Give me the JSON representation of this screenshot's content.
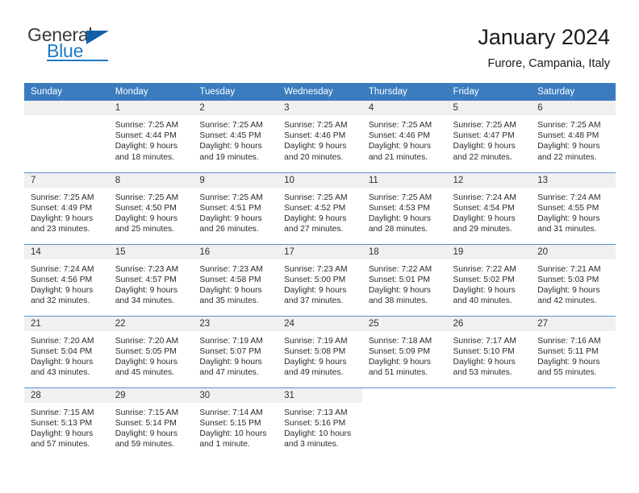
{
  "brand": {
    "name_part1": "General",
    "name_part2": "Blue",
    "accent_color": "#1f7ac4",
    "triangle_color": "#1360a8"
  },
  "header": {
    "title": "January 2024",
    "subtitle": "Furore, Campania, Italy"
  },
  "calendar": {
    "header_bg": "#3a7cbe",
    "daynum_bg": "#f0f0f0",
    "weekday_headers": [
      "Sunday",
      "Monday",
      "Tuesday",
      "Wednesday",
      "Thursday",
      "Friday",
      "Saturday"
    ],
    "weeks": [
      [
        {
          "day": "",
          "sunrise": "",
          "sunset": "",
          "daylight_line1": "",
          "daylight_line2": "",
          "blank": true
        },
        {
          "day": "1",
          "sunrise": "Sunrise: 7:25 AM",
          "sunset": "Sunset: 4:44 PM",
          "daylight_line1": "Daylight: 9 hours",
          "daylight_line2": "and 18 minutes."
        },
        {
          "day": "2",
          "sunrise": "Sunrise: 7:25 AM",
          "sunset": "Sunset: 4:45 PM",
          "daylight_line1": "Daylight: 9 hours",
          "daylight_line2": "and 19 minutes."
        },
        {
          "day": "3",
          "sunrise": "Sunrise: 7:25 AM",
          "sunset": "Sunset: 4:46 PM",
          "daylight_line1": "Daylight: 9 hours",
          "daylight_line2": "and 20 minutes."
        },
        {
          "day": "4",
          "sunrise": "Sunrise: 7:25 AM",
          "sunset": "Sunset: 4:46 PM",
          "daylight_line1": "Daylight: 9 hours",
          "daylight_line2": "and 21 minutes."
        },
        {
          "day": "5",
          "sunrise": "Sunrise: 7:25 AM",
          "sunset": "Sunset: 4:47 PM",
          "daylight_line1": "Daylight: 9 hours",
          "daylight_line2": "and 22 minutes."
        },
        {
          "day": "6",
          "sunrise": "Sunrise: 7:25 AM",
          "sunset": "Sunset: 4:48 PM",
          "daylight_line1": "Daylight: 9 hours",
          "daylight_line2": "and 22 minutes."
        }
      ],
      [
        {
          "day": "7",
          "sunrise": "Sunrise: 7:25 AM",
          "sunset": "Sunset: 4:49 PM",
          "daylight_line1": "Daylight: 9 hours",
          "daylight_line2": "and 23 minutes."
        },
        {
          "day": "8",
          "sunrise": "Sunrise: 7:25 AM",
          "sunset": "Sunset: 4:50 PM",
          "daylight_line1": "Daylight: 9 hours",
          "daylight_line2": "and 25 minutes."
        },
        {
          "day": "9",
          "sunrise": "Sunrise: 7:25 AM",
          "sunset": "Sunset: 4:51 PM",
          "daylight_line1": "Daylight: 9 hours",
          "daylight_line2": "and 26 minutes."
        },
        {
          "day": "10",
          "sunrise": "Sunrise: 7:25 AM",
          "sunset": "Sunset: 4:52 PM",
          "daylight_line1": "Daylight: 9 hours",
          "daylight_line2": "and 27 minutes."
        },
        {
          "day": "11",
          "sunrise": "Sunrise: 7:25 AM",
          "sunset": "Sunset: 4:53 PM",
          "daylight_line1": "Daylight: 9 hours",
          "daylight_line2": "and 28 minutes."
        },
        {
          "day": "12",
          "sunrise": "Sunrise: 7:24 AM",
          "sunset": "Sunset: 4:54 PM",
          "daylight_line1": "Daylight: 9 hours",
          "daylight_line2": "and 29 minutes."
        },
        {
          "day": "13",
          "sunrise": "Sunrise: 7:24 AM",
          "sunset": "Sunset: 4:55 PM",
          "daylight_line1": "Daylight: 9 hours",
          "daylight_line2": "and 31 minutes."
        }
      ],
      [
        {
          "day": "14",
          "sunrise": "Sunrise: 7:24 AM",
          "sunset": "Sunset: 4:56 PM",
          "daylight_line1": "Daylight: 9 hours",
          "daylight_line2": "and 32 minutes."
        },
        {
          "day": "15",
          "sunrise": "Sunrise: 7:23 AM",
          "sunset": "Sunset: 4:57 PM",
          "daylight_line1": "Daylight: 9 hours",
          "daylight_line2": "and 34 minutes."
        },
        {
          "day": "16",
          "sunrise": "Sunrise: 7:23 AM",
          "sunset": "Sunset: 4:58 PM",
          "daylight_line1": "Daylight: 9 hours",
          "daylight_line2": "and 35 minutes."
        },
        {
          "day": "17",
          "sunrise": "Sunrise: 7:23 AM",
          "sunset": "Sunset: 5:00 PM",
          "daylight_line1": "Daylight: 9 hours",
          "daylight_line2": "and 37 minutes."
        },
        {
          "day": "18",
          "sunrise": "Sunrise: 7:22 AM",
          "sunset": "Sunset: 5:01 PM",
          "daylight_line1": "Daylight: 9 hours",
          "daylight_line2": "and 38 minutes."
        },
        {
          "day": "19",
          "sunrise": "Sunrise: 7:22 AM",
          "sunset": "Sunset: 5:02 PM",
          "daylight_line1": "Daylight: 9 hours",
          "daylight_line2": "and 40 minutes."
        },
        {
          "day": "20",
          "sunrise": "Sunrise: 7:21 AM",
          "sunset": "Sunset: 5:03 PM",
          "daylight_line1": "Daylight: 9 hours",
          "daylight_line2": "and 42 minutes."
        }
      ],
      [
        {
          "day": "21",
          "sunrise": "Sunrise: 7:20 AM",
          "sunset": "Sunset: 5:04 PM",
          "daylight_line1": "Daylight: 9 hours",
          "daylight_line2": "and 43 minutes."
        },
        {
          "day": "22",
          "sunrise": "Sunrise: 7:20 AM",
          "sunset": "Sunset: 5:05 PM",
          "daylight_line1": "Daylight: 9 hours",
          "daylight_line2": "and 45 minutes."
        },
        {
          "day": "23",
          "sunrise": "Sunrise: 7:19 AM",
          "sunset": "Sunset: 5:07 PM",
          "daylight_line1": "Daylight: 9 hours",
          "daylight_line2": "and 47 minutes."
        },
        {
          "day": "24",
          "sunrise": "Sunrise: 7:19 AM",
          "sunset": "Sunset: 5:08 PM",
          "daylight_line1": "Daylight: 9 hours",
          "daylight_line2": "and 49 minutes."
        },
        {
          "day": "25",
          "sunrise": "Sunrise: 7:18 AM",
          "sunset": "Sunset: 5:09 PM",
          "daylight_line1": "Daylight: 9 hours",
          "daylight_line2": "and 51 minutes."
        },
        {
          "day": "26",
          "sunrise": "Sunrise: 7:17 AM",
          "sunset": "Sunset: 5:10 PM",
          "daylight_line1": "Daylight: 9 hours",
          "daylight_line2": "and 53 minutes."
        },
        {
          "day": "27",
          "sunrise": "Sunrise: 7:16 AM",
          "sunset": "Sunset: 5:11 PM",
          "daylight_line1": "Daylight: 9 hours",
          "daylight_line2": "and 55 minutes."
        }
      ],
      [
        {
          "day": "28",
          "sunrise": "Sunrise: 7:15 AM",
          "sunset": "Sunset: 5:13 PM",
          "daylight_line1": "Daylight: 9 hours",
          "daylight_line2": "and 57 minutes."
        },
        {
          "day": "29",
          "sunrise": "Sunrise: 7:15 AM",
          "sunset": "Sunset: 5:14 PM",
          "daylight_line1": "Daylight: 9 hours",
          "daylight_line2": "and 59 minutes."
        },
        {
          "day": "30",
          "sunrise": "Sunrise: 7:14 AM",
          "sunset": "Sunset: 5:15 PM",
          "daylight_line1": "Daylight: 10 hours",
          "daylight_line2": "and 1 minute."
        },
        {
          "day": "31",
          "sunrise": "Sunrise: 7:13 AM",
          "sunset": "Sunset: 5:16 PM",
          "daylight_line1": "Daylight: 10 hours",
          "daylight_line2": "and 3 minutes."
        },
        {
          "day": "",
          "sunrise": "",
          "sunset": "",
          "daylight_line1": "",
          "daylight_line2": "",
          "outside": true
        },
        {
          "day": "",
          "sunrise": "",
          "sunset": "",
          "daylight_line1": "",
          "daylight_line2": "",
          "outside": true
        },
        {
          "day": "",
          "sunrise": "",
          "sunset": "",
          "daylight_line1": "",
          "daylight_line2": "",
          "outside": true
        }
      ]
    ]
  }
}
